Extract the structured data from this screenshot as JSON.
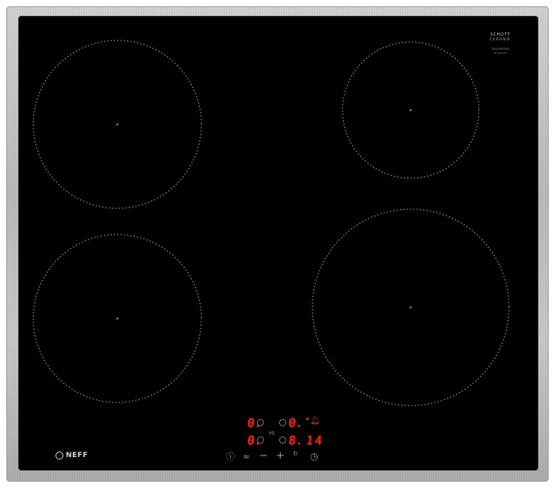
{
  "glass_logo": {
    "line1": "SCHOTT",
    "line2": "CERAN®",
    "line3": "TOUCHSTYLE",
    "line4": "BY SCHOTT"
  },
  "brand": {
    "name": "NEFF"
  },
  "display": {
    "zone_top_left": "0.",
    "zone_top_right": "0.",
    "zone_bottom_left": "0.",
    "zone_bottom_right": "8.",
    "timer": "14",
    "hi_label": "HI"
  },
  "controls": {
    "info_icon": "ⓘ",
    "wipe_icon": "≈",
    "minus": "−",
    "plus": "+",
    "lock_icon": "ᵇ",
    "timer_icon": "◷"
  },
  "colors": {
    "frame": "#bcbcbc",
    "glass": "#000000",
    "display_red": "#ff2a1a",
    "zone_dots": "#7d7d7d"
  }
}
